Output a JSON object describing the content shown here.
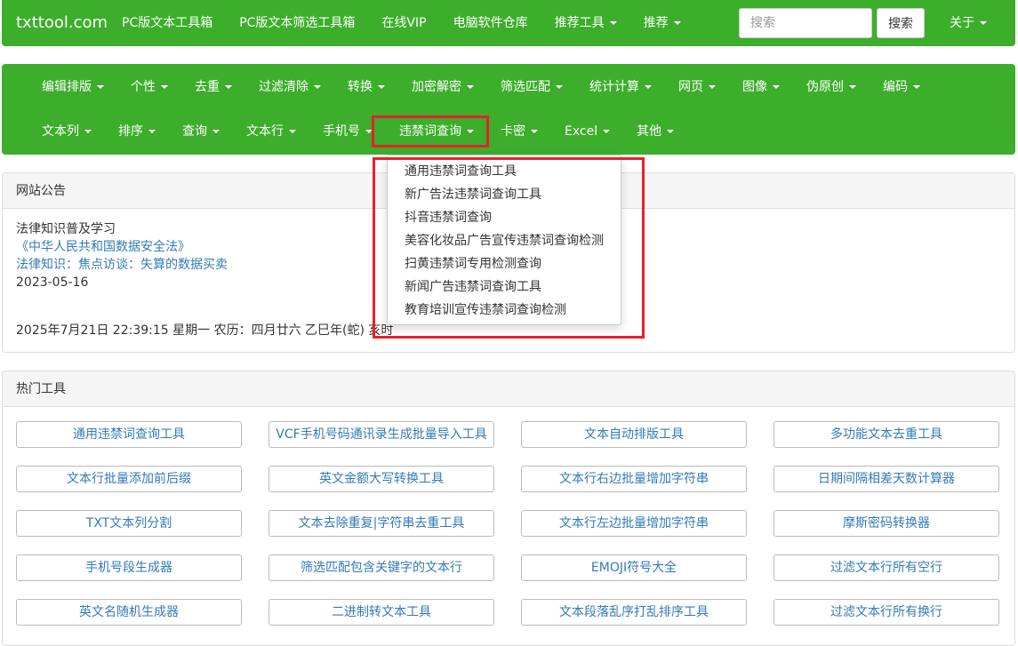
{
  "topbar": {
    "brand": "txttool.com",
    "nav": [
      {
        "label": "PC版文本工具箱",
        "dropdown": false
      },
      {
        "label": "PC版文本筛选工具箱",
        "dropdown": false
      },
      {
        "label": "在线VIP",
        "dropdown": false
      },
      {
        "label": "电脑软件仓库",
        "dropdown": false
      },
      {
        "label": "推荐工具",
        "dropdown": true
      },
      {
        "label": "推荐",
        "dropdown": true
      }
    ],
    "search_placeholder": "搜索",
    "search_button": "搜索",
    "about": "关于"
  },
  "categories": {
    "row1": [
      "编辑排版",
      "个性",
      "去重",
      "过滤清除",
      "转换",
      "加密解密",
      "筛选匹配",
      "统计计算",
      "网页",
      "图像",
      "伪原创",
      "编码"
    ],
    "row2": [
      "文本列",
      "排序",
      "查询",
      "文本行",
      "手机号",
      "违禁词查询",
      "卡密",
      "Excel",
      "其他"
    ],
    "active": "违禁词查询"
  },
  "dropdown": {
    "items": [
      "通用违禁词查询工具",
      "新广告法违禁词查询工具",
      "抖音违禁词查询",
      "美容化妆品广告宣传违禁词查询检测",
      "扫黄违禁词专用检测查询",
      "新闻广告违禁词查询工具",
      "教育培训宣传违禁词查询检测"
    ]
  },
  "notice": {
    "title": "网站公告",
    "line1": "法律知识普及学习",
    "link1": "《中华人民共和国数据安全法》",
    "link2": "法律知识：焦点访谈：失算的数据买卖",
    "date": "2023-05-16",
    "datetime": "2025年7月21日 22:39:15 星期一 农历：四月廿六     乙巳年(蛇) 亥时"
  },
  "hot": {
    "title": "热门工具",
    "tools": [
      [
        "通用违禁词查询工具",
        "VCF手机号码通讯录生成批量导入工具",
        "文本自动排版工具",
        "多功能文本去重工具"
      ],
      [
        "文本行批量添加前后缀",
        "英文金额大写转换工具",
        "文本行右边批量增加字符串",
        "日期间隔相差天数计算器"
      ],
      [
        "TXT文本列分割",
        "文本去除重复|字符串去重工具",
        "文本行左边批量增加字符串",
        "摩斯密码转换器"
      ],
      [
        "手机号段生成器",
        "筛选匹配包含关键字的文本行",
        "EMOJI符号大全",
        "过滤文本行所有空行"
      ],
      [
        "英文名随机生成器",
        "二进制转文本工具",
        "文本段落乱序打乱排序工具",
        "过滤文本行所有换行"
      ]
    ]
  },
  "colors": {
    "nav_green": "#3cae2b",
    "highlight_red": "#e8202a",
    "link_blue": "#337ab7"
  }
}
